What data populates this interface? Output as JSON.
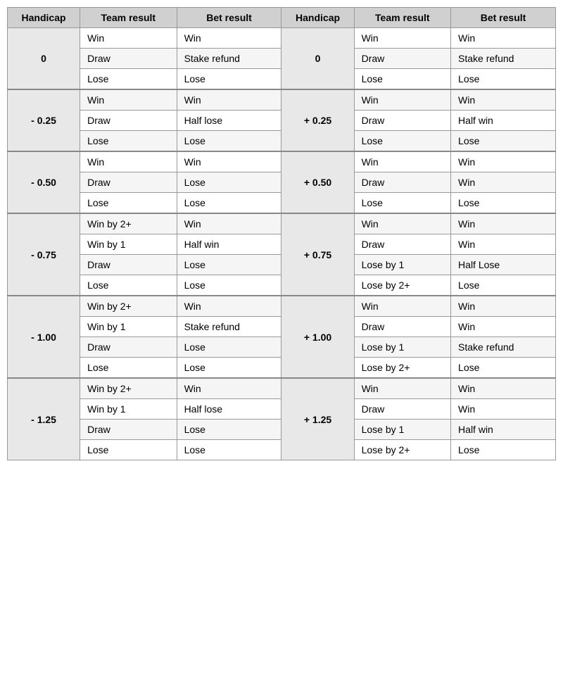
{
  "headers": [
    "Handicap",
    "Team result",
    "Bet result",
    "Handicap",
    "Team result",
    "Bet result"
  ],
  "sections": [
    {
      "left_handicap": "0",
      "right_handicap": "0",
      "rows": [
        {
          "left_team": "Win",
          "left_bet": "Win",
          "right_team": "Win",
          "right_bet": "Win"
        },
        {
          "left_team": "Draw",
          "left_bet": "Stake refund",
          "right_team": "Draw",
          "right_bet": "Stake refund"
        },
        {
          "left_team": "Lose",
          "left_bet": "Lose",
          "right_team": "Lose",
          "right_bet": "Lose"
        }
      ]
    },
    {
      "left_handicap": "- 0.25",
      "right_handicap": "+ 0.25",
      "rows": [
        {
          "left_team": "Win",
          "left_bet": "Win",
          "right_team": "Win",
          "right_bet": "Win"
        },
        {
          "left_team": "Draw",
          "left_bet": "Half lose",
          "right_team": "Draw",
          "right_bet": "Half win"
        },
        {
          "left_team": "Lose",
          "left_bet": "Lose",
          "right_team": "Lose",
          "right_bet": "Lose"
        }
      ]
    },
    {
      "left_handicap": "- 0.50",
      "right_handicap": "+ 0.50",
      "rows": [
        {
          "left_team": "Win",
          "left_bet": "Win",
          "right_team": "Win",
          "right_bet": "Win"
        },
        {
          "left_team": "Draw",
          "left_bet": "Lose",
          "right_team": "Draw",
          "right_bet": "Win"
        },
        {
          "left_team": "Lose",
          "left_bet": "Lose",
          "right_team": "Lose",
          "right_bet": "Lose"
        }
      ]
    },
    {
      "left_handicap": "- 0.75",
      "right_handicap": "+ 0.75",
      "rows": [
        {
          "left_team": "Win by 2+",
          "left_bet": "Win",
          "right_team": "Win",
          "right_bet": "Win"
        },
        {
          "left_team": "Win by 1",
          "left_bet": "Half win",
          "right_team": "Draw",
          "right_bet": "Win"
        },
        {
          "left_team": "Draw",
          "left_bet": "Lose",
          "right_team": "Lose by 1",
          "right_bet": "Half Lose"
        },
        {
          "left_team": "Lose",
          "left_bet": "Lose",
          "right_team": "Lose by 2+",
          "right_bet": "Lose"
        }
      ]
    },
    {
      "left_handicap": "- 1.00",
      "right_handicap": "+ 1.00",
      "rows": [
        {
          "left_team": "Win by 2+",
          "left_bet": "Win",
          "right_team": "Win",
          "right_bet": "Win"
        },
        {
          "left_team": "Win by 1",
          "left_bet": "Stake refund",
          "right_team": "Draw",
          "right_bet": "Win"
        },
        {
          "left_team": "Draw",
          "left_bet": "Lose",
          "right_team": "Lose by 1",
          "right_bet": "Stake refund"
        },
        {
          "left_team": "Lose",
          "left_bet": "Lose",
          "right_team": "Lose by 2+",
          "right_bet": "Lose"
        }
      ]
    },
    {
      "left_handicap": "- 1.25",
      "right_handicap": "+ 1.25",
      "rows": [
        {
          "left_team": "Win by 2+",
          "left_bet": "Win",
          "right_team": "Win",
          "right_bet": "Win"
        },
        {
          "left_team": "Win by 1",
          "left_bet": "Half lose",
          "right_team": "Draw",
          "right_bet": "Win"
        },
        {
          "left_team": "Draw",
          "left_bet": "Lose",
          "right_team": "Lose by 1",
          "right_bet": "Half win"
        },
        {
          "left_team": "Lose",
          "left_bet": "Lose",
          "right_team": "Lose by 2+",
          "right_bet": "Lose"
        }
      ]
    }
  ]
}
